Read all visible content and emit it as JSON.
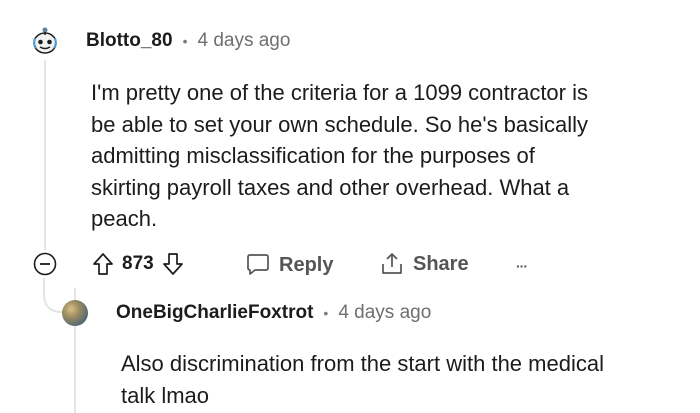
{
  "comment": {
    "username": "Blotto_80",
    "timestamp": "4 days ago",
    "body_lines": [
      "I'm pretty one of the criteria for a 1099 contractor is",
      "be able to set your own schedule. So he's basically",
      "admitting misclassification for the purposes of",
      "skirting payroll taxes and other overhead. What a",
      "peach."
    ],
    "votes": "873",
    "reply_label": "Reply",
    "share_label": "Share",
    "more_label": "···"
  },
  "reply": {
    "username": "OneBigCharlieFoxtrot",
    "timestamp": "4 days ago",
    "body_lines": [
      "Also discrimination from the start with the medical",
      "talk lmao"
    ]
  },
  "colors": {
    "text": "#1c1c1c",
    "muted": "#6f6f6f",
    "thread_line": "#e5e5e5"
  },
  "icons": [
    "snoo-avatar-icon",
    "collapse-icon",
    "upvote-icon",
    "downvote-icon",
    "reply-icon",
    "share-icon",
    "more-icon"
  ]
}
